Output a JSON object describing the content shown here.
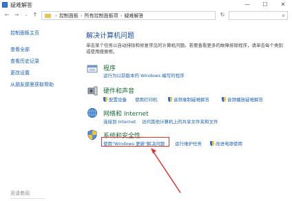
{
  "window": {
    "title": "疑难解答",
    "minimize_glyph": "—",
    "maximize_glyph": "☐",
    "close_glyph": "✕"
  },
  "nav": {
    "back_glyph": "←",
    "forward_glyph": "→",
    "up_glyph": "↑",
    "dropdown_glyph": "⌄",
    "breadcrumb": [
      "控制面板",
      "所有控制面板项",
      "疑难解答"
    ],
    "separator": "›",
    "refresh_glyph": "↻",
    "search_glyph": "⌕"
  },
  "sidebar": {
    "home": "控制面板主页",
    "links": [
      "查看全部",
      "查看历史记录",
      "更改设置",
      "从朋友那里获取帮助"
    ],
    "see_also": "另请参阅"
  },
  "main": {
    "heading": "解决计算机问题",
    "description": "单击某个任务以自动排除和修复常见的计算机问题。若要查看更多的故障排除程序，请单击每个类别或使用搜索框。",
    "categories": [
      {
        "title": "程序",
        "links": [
          "运行为以前版本的 Windows 编写的程序"
        ]
      },
      {
        "title": "硬件和声音",
        "links": [
          "配置设备",
          "使用打印机",
          "音频录制疑难解答",
          "音频播放疑难解答"
        ]
      },
      {
        "title": "网络和 Internet",
        "links": [
          "连接到 Internet",
          "访问其他计算机上的共享文件夹和文件"
        ]
      },
      {
        "title": "系统和安全性",
        "links": [
          "使用\"Windows 更新\"解决问题",
          "运行维护任务",
          "改进电源使用"
        ]
      }
    ]
  },
  "colors": {
    "link": "#1a5fb4",
    "category_title": "#1b6b3a",
    "heading": "#1b4fa3",
    "highlight": "#e8302a"
  },
  "icons": {
    "programs": "programs-icon",
    "hardware": "hardware-sound-icon",
    "network": "network-icon",
    "system": "system-security-icon"
  }
}
